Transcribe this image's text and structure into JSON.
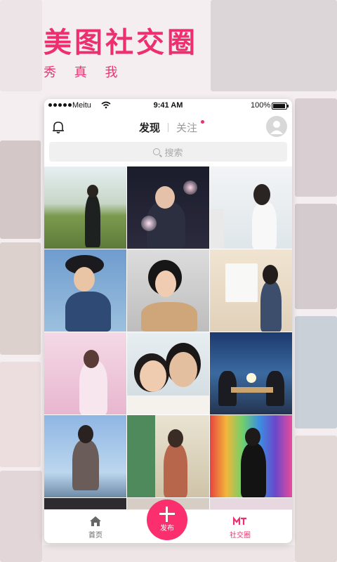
{
  "hero": {
    "title": "美图社交圈",
    "subtitle": "秀 真 我"
  },
  "status_bar": {
    "carrier": "Meitu",
    "time": "9:41 AM",
    "battery": "100%"
  },
  "header": {
    "tabs": [
      {
        "label": "发现",
        "active": true
      },
      {
        "label": "关注",
        "active": false,
        "has_badge": true
      }
    ]
  },
  "search": {
    "placeholder": "搜索"
  },
  "bottom_nav": {
    "home_label": "首页",
    "publish_label": "发布",
    "social_label": "社交圈"
  },
  "colors": {
    "accent": "#ee2f6f",
    "publish_button": "#fb2f6e"
  },
  "icons": {
    "notification": "bell-icon",
    "search": "search-icon",
    "home": "home-icon",
    "publish": "plus-icon",
    "social": "social-circle-icon",
    "profile": "avatar-icon"
  }
}
